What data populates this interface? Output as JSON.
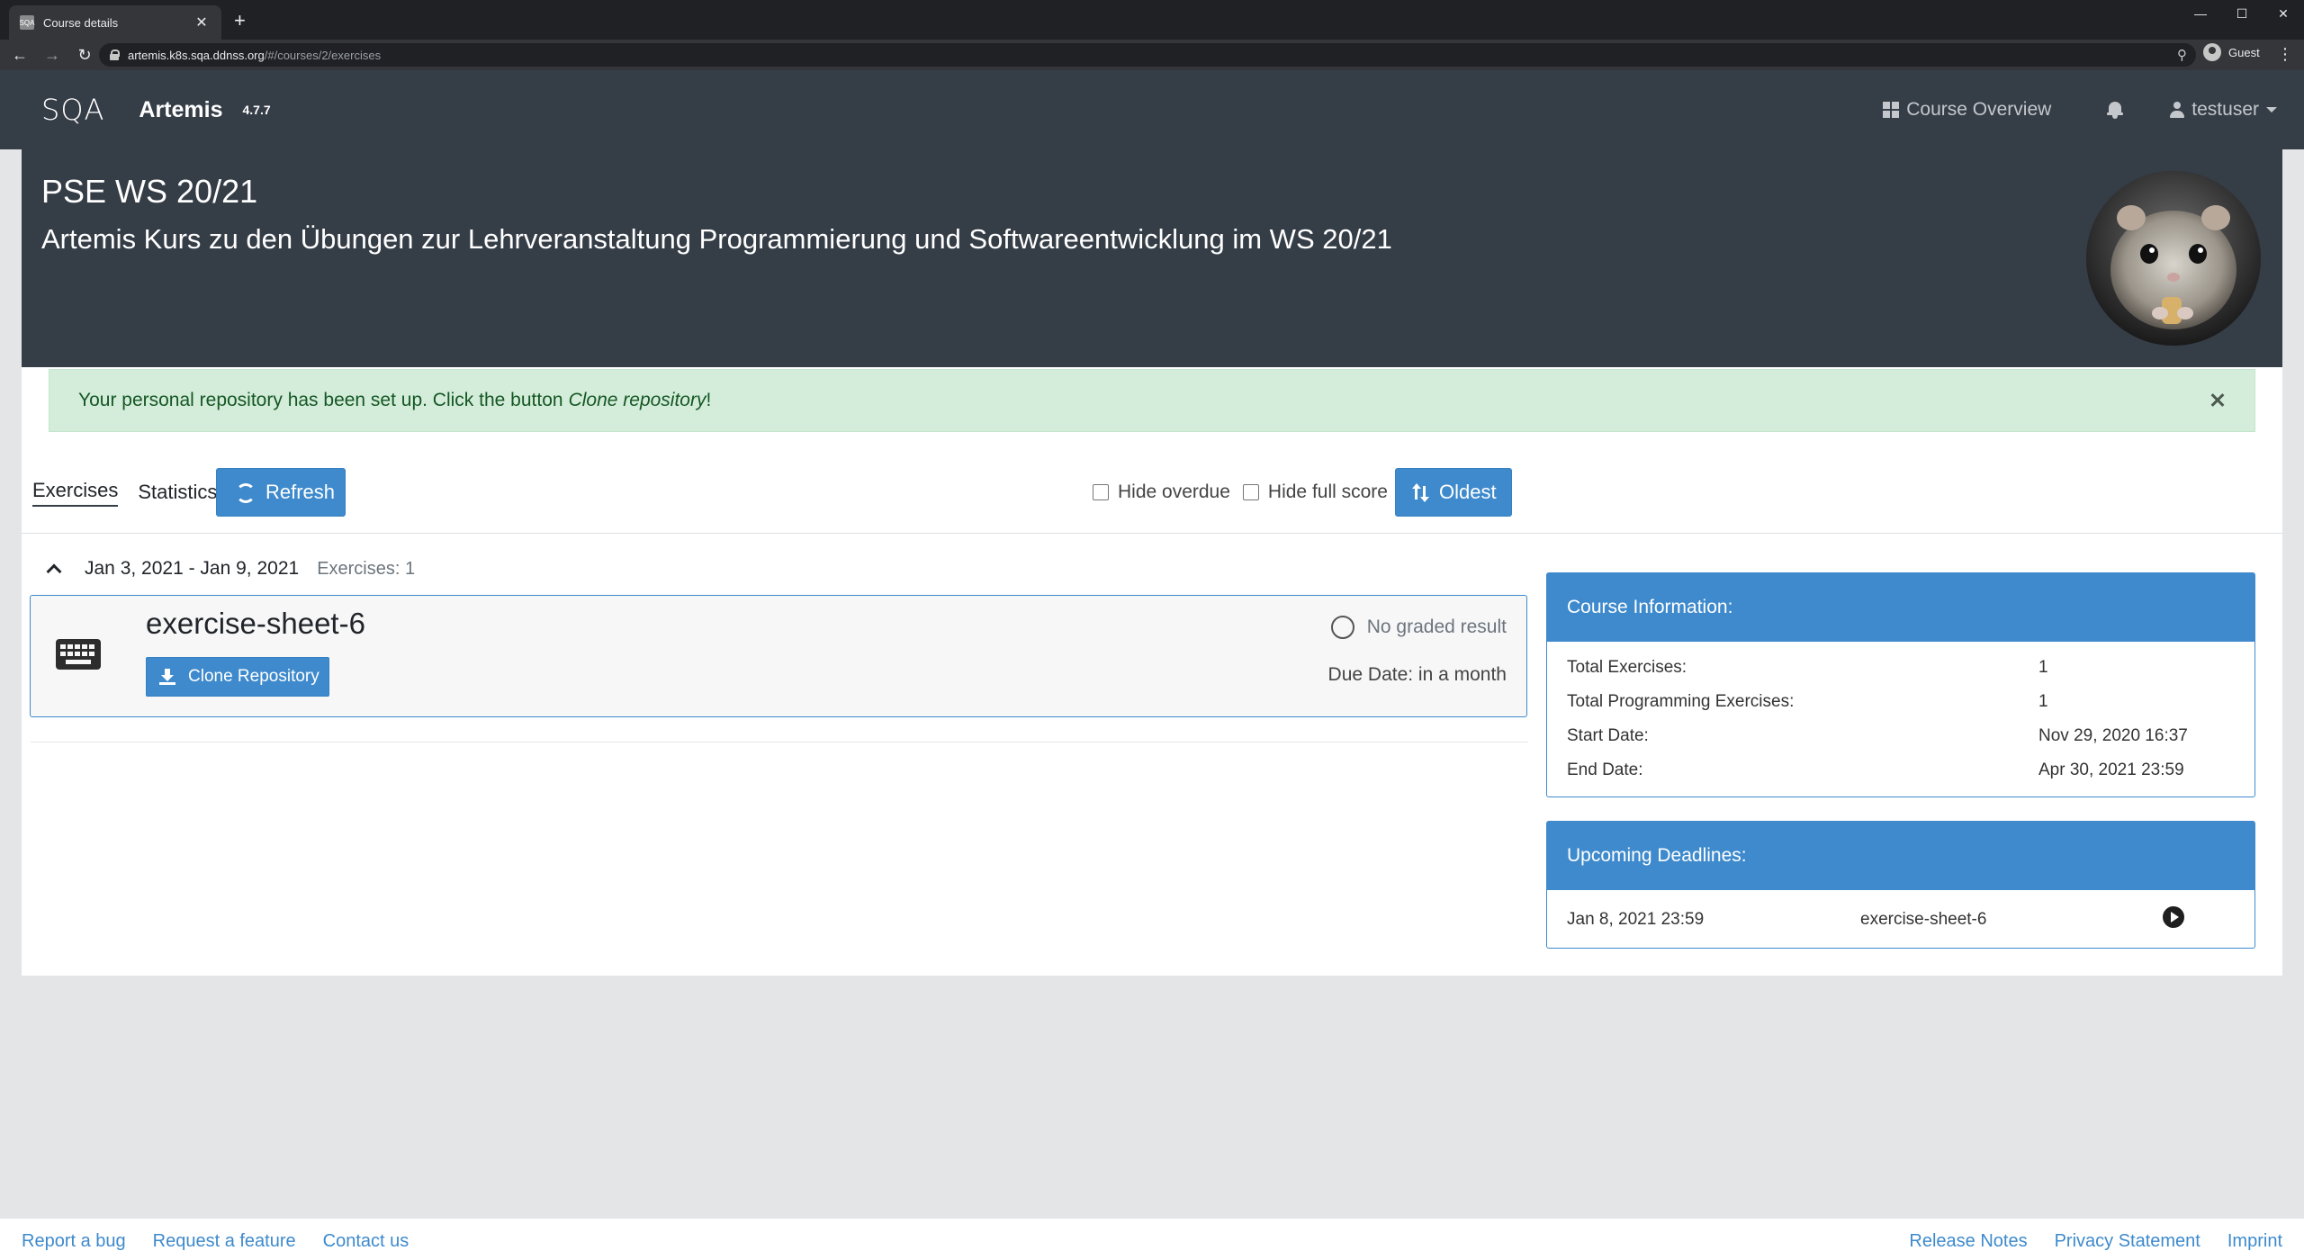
{
  "browser": {
    "tab_title": "Course details",
    "tab_favicon_text": "SQA",
    "url_host": "artemis.k8s.sqa.ddnss.org",
    "url_path": "/#/courses/2/exercises",
    "profile_label": "Guest"
  },
  "navbar": {
    "logo": "SQA",
    "app_name": "Artemis",
    "version": "4.7.7",
    "course_overview": "Course Overview",
    "username": "testuser"
  },
  "course": {
    "title": "PSE WS 20/21",
    "description": "Artemis Kurs zu den Übungen zur Lehrveranstaltung Programmierung und Softwareentwicklung im WS 20/21"
  },
  "alert": {
    "text": "Your personal repository has been set up. Click the button",
    "emphasis": "Clone repository",
    "suffix": "!"
  },
  "tabs": {
    "exercises": "Exercises",
    "statistics": "Statistics",
    "refresh": "Refresh"
  },
  "filters": {
    "hide_overdue": "Hide overdue",
    "hide_full_score": "Hide full score",
    "sort": "Oldest"
  },
  "week": {
    "range": "Jan 3, 2021 - Jan 9, 2021",
    "count": "Exercises: 1"
  },
  "exercise": {
    "title": "exercise-sheet-6",
    "clone_button": "Clone Repository",
    "result": "No graded result",
    "due": "Due Date: in a month"
  },
  "course_info": {
    "header": "Course Information:",
    "rows": [
      {
        "label": "Total Exercises:",
        "value": "1"
      },
      {
        "label": "Total Programming Exercises:",
        "value": "1"
      },
      {
        "label": "Start Date:",
        "value": "Nov 29, 2020 16:37"
      },
      {
        "label": "End Date:",
        "value": "Apr 30, 2021 23:59"
      }
    ]
  },
  "deadlines": {
    "header": "Upcoming Deadlines:",
    "items": [
      {
        "date": "Jan 8, 2021 23:59",
        "name": "exercise-sheet-6"
      }
    ]
  },
  "footer": {
    "report_bug": "Report a bug",
    "request_feature": "Request a feature",
    "contact": "Contact us",
    "release_notes": "Release Notes",
    "privacy": "Privacy Statement",
    "imprint": "Imprint"
  },
  "colors": {
    "primary": "#3e8acc",
    "navbar": "#353d47",
    "alert_bg": "#d4edda"
  }
}
